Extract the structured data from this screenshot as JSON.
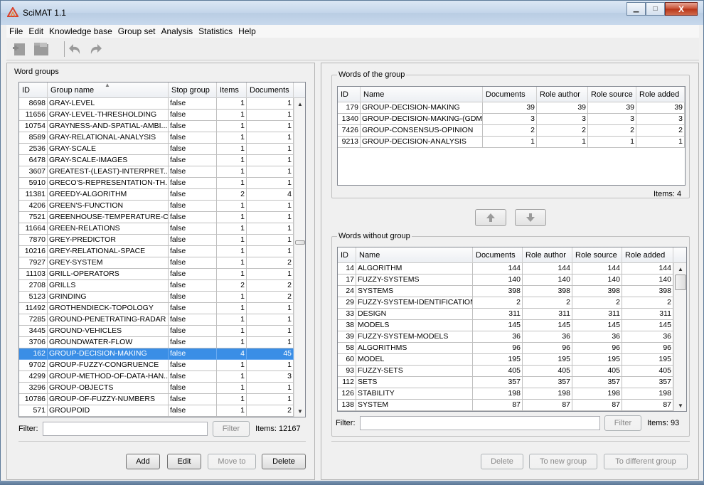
{
  "app": {
    "title": "SciMAT 1.1"
  },
  "menu": [
    "File",
    "Edit",
    "Knowledge base",
    "Group set",
    "Analysis",
    "Statistics",
    "Help"
  ],
  "window_buttons": {
    "minimize": "▁",
    "maximize": "□",
    "close": "X"
  },
  "left": {
    "title": "Word groups",
    "columns": [
      "ID",
      "Group name",
      "Stop group",
      "Items",
      "Documents"
    ],
    "rows": [
      [
        "8698",
        "GRAY-LEVEL",
        "false",
        "1",
        "1"
      ],
      [
        "11656",
        "GRAY-LEVEL-THRESHOLDING",
        "false",
        "1",
        "1"
      ],
      [
        "10754",
        "GRAYNESS-AND-SPATIAL-AMBI...",
        "false",
        "1",
        "1"
      ],
      [
        "8589",
        "GRAY-RELATIONAL-ANALYSIS",
        "false",
        "1",
        "1"
      ],
      [
        "2536",
        "GRAY-SCALE",
        "false",
        "1",
        "1"
      ],
      [
        "6478",
        "GRAY-SCALE-IMAGES",
        "false",
        "1",
        "1"
      ],
      [
        "3607",
        "GREATEST-(LEAST)-INTERPRET...",
        "false",
        "1",
        "1"
      ],
      [
        "5910",
        "GRECO'S-REPRESENTATION-TH...",
        "false",
        "1",
        "1"
      ],
      [
        "11381",
        "GREEDY-ALGORITHM",
        "false",
        "2",
        "4"
      ],
      [
        "4206",
        "GREEN'S-FUNCTION",
        "false",
        "1",
        "1"
      ],
      [
        "7521",
        "GREENHOUSE-TEMPERATURE-C...",
        "false",
        "1",
        "1"
      ],
      [
        "11664",
        "GREEN-RELATIONS",
        "false",
        "1",
        "1"
      ],
      [
        "7870",
        "GREY-PREDICTOR",
        "false",
        "1",
        "1"
      ],
      [
        "10216",
        "GREY-RELATIONAL-SPACE",
        "false",
        "1",
        "1"
      ],
      [
        "7927",
        "GREY-SYSTEM",
        "false",
        "1",
        "2"
      ],
      [
        "11103",
        "GRILL-OPERATORS",
        "false",
        "1",
        "1"
      ],
      [
        "2708",
        "GRILLS",
        "false",
        "2",
        "2"
      ],
      [
        "5123",
        "GRINDING",
        "false",
        "1",
        "2"
      ],
      [
        "11492",
        "GROTHENDIECK-TOPOLOGY",
        "false",
        "1",
        "1"
      ],
      [
        "7285",
        "GROUND-PENETRATING-RADAR",
        "false",
        "1",
        "1"
      ],
      [
        "3445",
        "GROUND-VEHICLES",
        "false",
        "1",
        "1"
      ],
      [
        "3706",
        "GROUNDWATER-FLOW",
        "false",
        "1",
        "1"
      ],
      [
        "162",
        "GROUP-DECISION-MAKING",
        "false",
        "4",
        "45"
      ],
      [
        "9702",
        "GROUP-FUZZY-CONGRUENCE",
        "false",
        "1",
        "1"
      ],
      [
        "4299",
        "GROUP-METHOD-OF-DATA-HAN...",
        "false",
        "1",
        "3"
      ],
      [
        "3296",
        "GROUP-OBJECTS",
        "false",
        "1",
        "1"
      ],
      [
        "10786",
        "GROUP-OF-FUZZY-NUMBERS",
        "false",
        "1",
        "1"
      ],
      [
        "571",
        "GROUPOID",
        "false",
        "1",
        "2"
      ]
    ],
    "selected_index": 22,
    "filter_label": "Filter:",
    "filter_value": "",
    "filter_button": "Filter",
    "items_label": "Items:",
    "items_count": "12167",
    "buttons": {
      "add": "Add",
      "edit": "Edit",
      "move_to": "Move to",
      "delete": "Delete"
    }
  },
  "words_of_group": {
    "title": "Words of the group",
    "columns": [
      "ID",
      "Name",
      "Documents",
      "Role author",
      "Role source",
      "Role added"
    ],
    "rows": [
      [
        "179",
        "GROUP-DECISION-MAKING",
        "39",
        "39",
        "39",
        "39"
      ],
      [
        "1340",
        "GROUP-DECISION-MAKING-(GDM)",
        "3",
        "3",
        "3",
        "3"
      ],
      [
        "7426",
        "GROUP-CONSENSUS-OPINION",
        "2",
        "2",
        "2",
        "2"
      ],
      [
        "9213",
        "GROUP-DECISION-ANALYSIS",
        "1",
        "1",
        "1",
        "1"
      ]
    ],
    "items_label": "Items:",
    "items_count": "4"
  },
  "words_without_group": {
    "title": "Words without group",
    "columns": [
      "ID",
      "Name",
      "Documents",
      "Role author",
      "Role source",
      "Role added"
    ],
    "rows": [
      [
        "14",
        "ALGORITHM",
        "144",
        "144",
        "144",
        "144"
      ],
      [
        "17",
        "FUZZY-SYSTEMS",
        "140",
        "140",
        "140",
        "140"
      ],
      [
        "24",
        "SYSTEMS",
        "398",
        "398",
        "398",
        "398"
      ],
      [
        "29",
        "FUZZY-SYSTEM-IDENTIFICATION",
        "2",
        "2",
        "2",
        "2"
      ],
      [
        "33",
        "DESIGN",
        "311",
        "311",
        "311",
        "311"
      ],
      [
        "38",
        "MODELS",
        "145",
        "145",
        "145",
        "145"
      ],
      [
        "39",
        "FUZZY-SYSTEM-MODELS",
        "36",
        "36",
        "36",
        "36"
      ],
      [
        "58",
        "ALGORITHMS",
        "96",
        "96",
        "96",
        "96"
      ],
      [
        "60",
        "MODEL",
        "195",
        "195",
        "195",
        "195"
      ],
      [
        "93",
        "FUZZY-SETS",
        "405",
        "405",
        "405",
        "405"
      ],
      [
        "112",
        "SETS",
        "357",
        "357",
        "357",
        "357"
      ],
      [
        "126",
        "STABILITY",
        "198",
        "198",
        "198",
        "198"
      ],
      [
        "138",
        "SYSTEM",
        "87",
        "87",
        "87",
        "87"
      ]
    ],
    "filter_label": "Filter:",
    "filter_value": "",
    "filter_button": "Filter",
    "items_label": "Items:",
    "items_count": "93",
    "buttons": {
      "delete": "Delete",
      "to_new_group": "To new group",
      "to_different_group": "To different group"
    }
  },
  "colors": {
    "selection": "#3a8ee6",
    "title_bar": "#c4d6ea",
    "close_button": "#c74f33"
  }
}
